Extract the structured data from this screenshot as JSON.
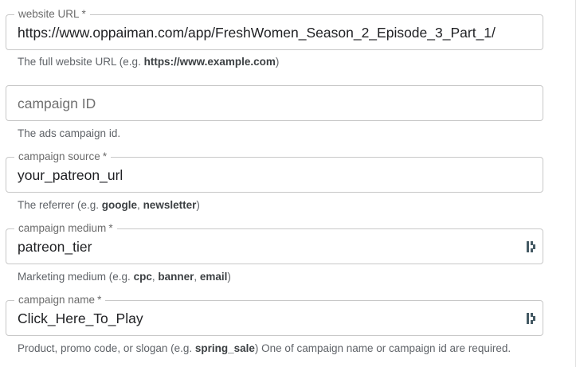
{
  "fields": {
    "website_url": {
      "label": "website URL",
      "required_mark": "*",
      "value": "https://www.oppaiman.com/app/FreshWomen_Season_2_Episode_3_Part_1/",
      "helper_prefix": "The full website URL (e.g. ",
      "helper_example": "https://www.example.com",
      "helper_suffix": ")"
    },
    "campaign_id": {
      "placeholder": "campaign ID",
      "helper": "The ads campaign id."
    },
    "campaign_source": {
      "label": "campaign source",
      "required_mark": "*",
      "value": "your_patreon_url",
      "helper_prefix": "The referrer (e.g. ",
      "helper_example_1": "google",
      "helper_sep": ", ",
      "helper_example_2": "newsletter",
      "helper_suffix": ")"
    },
    "campaign_medium": {
      "label": "campaign medium",
      "required_mark": "*",
      "value": "patreon_tier",
      "helper_prefix": "Marketing medium (e.g. ",
      "helper_example_1": "cpc",
      "helper_sep_1": ", ",
      "helper_example_2": "banner",
      "helper_sep_2": ", ",
      "helper_example_3": "email",
      "helper_suffix": ")"
    },
    "campaign_name": {
      "label": "campaign name",
      "required_mark": "*",
      "value": "Click_Here_To_Play",
      "helper_prefix": "Product, promo code, or slogan (e.g. ",
      "helper_example": "spring_sale",
      "helper_suffix": ") One of campaign name or campaign id are required."
    }
  },
  "icons": {
    "picker_icon": "variable-picker-icon",
    "picker_color": "#455a64"
  }
}
